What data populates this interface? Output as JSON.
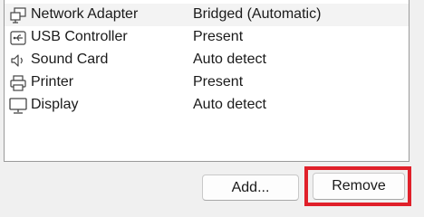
{
  "devices": [
    {
      "name": "Network Adapter",
      "summary": "Bridged (Automatic)",
      "icon": "network-adapter-icon"
    },
    {
      "name": "USB Controller",
      "summary": "Present",
      "icon": "usb-controller-icon"
    },
    {
      "name": "Sound Card",
      "summary": "Auto detect",
      "icon": "sound-card-icon"
    },
    {
      "name": "Printer",
      "summary": "Present",
      "icon": "printer-icon"
    },
    {
      "name": "Display",
      "summary": "Auto detect",
      "icon": "display-icon"
    }
  ],
  "buttons": {
    "add_label": "Add...",
    "remove_label": "Remove"
  },
  "colors": {
    "highlight": "#e0202a"
  }
}
